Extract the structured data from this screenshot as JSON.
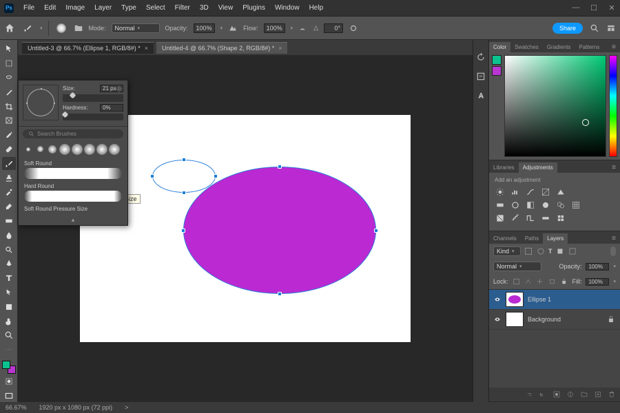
{
  "app": {
    "logo": "Ps"
  },
  "menu": [
    "File",
    "Edit",
    "Image",
    "Layer",
    "Type",
    "Select",
    "Filter",
    "3D",
    "View",
    "Plugins",
    "Window",
    "Help"
  ],
  "winctrl": {
    "min": "—",
    "max": "☐",
    "close": "✕"
  },
  "optbar": {
    "mode_label": "Mode:",
    "mode_value": "Normal",
    "opacity_label": "Opacity:",
    "opacity_value": "100%",
    "flow_label": "Flow:",
    "flow_value": "100%",
    "angle_label": "△",
    "angle_value": "0°",
    "share": "Share"
  },
  "brush_popup": {
    "size_label": "Size:",
    "size_value": "21 px",
    "hardness_label": "Hardness:",
    "hardness_value": "0%",
    "search_placeholder": "Search Brushes",
    "items": [
      "Soft Round",
      "Hard Round",
      "Soft Round Pressure Size"
    ],
    "tooltip": "Soft Round Pressure Size"
  },
  "tabs": [
    {
      "label": "Untitled-3 @ 66.7% (Ellipse 1, RGB/8#) *"
    },
    {
      "label": "Untitled-4 @ 66.7% (Shape 2, RGB/8#) *"
    }
  ],
  "color_tabs": [
    "Color",
    "Swatches",
    "Gradients",
    "Patterns"
  ],
  "swatch": {
    "fg": "#0cc28f",
    "bg": "#b936d1"
  },
  "lib_tabs": [
    "Libraries",
    "Adjustments"
  ],
  "adjust": {
    "hint": "Add an adjustment"
  },
  "layer_tabs": [
    "Channels",
    "Paths",
    "Layers"
  ],
  "layers": {
    "kind": "Kind",
    "blend": "Normal",
    "opacity_l": "Opacity:",
    "opacity_v": "100%",
    "lock_l": "Lock:",
    "fill_l": "Fill:",
    "fill_v": "100%",
    "items": [
      {
        "name": "Ellipse 1"
      },
      {
        "name": "Background"
      }
    ]
  },
  "status": {
    "zoom": "66.67%",
    "doc": "1920 px x 1080 px (72 ppi)",
    "arrow": ">"
  },
  "chart_data": {
    "type": "table",
    "note": "not a chart"
  }
}
